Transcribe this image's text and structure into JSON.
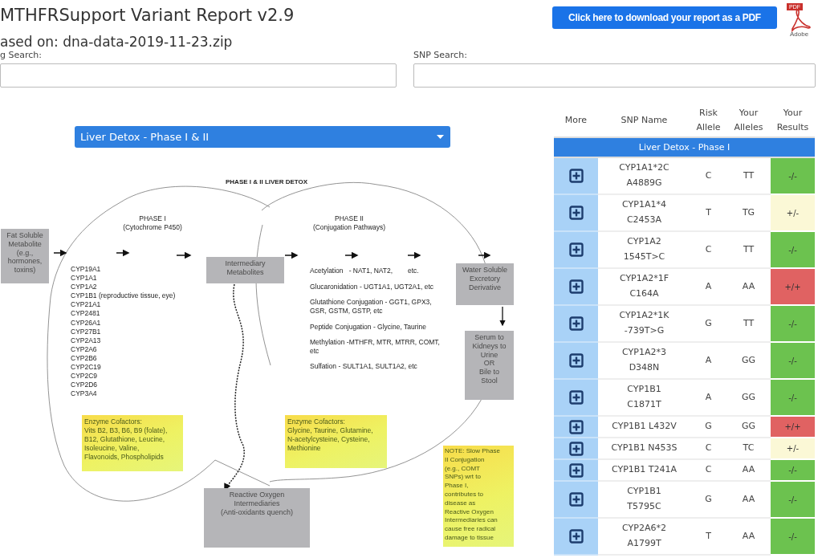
{
  "header": {
    "title": "MTHFRSupport Variant Report v2.9",
    "based_on": "ased on: dna-data-2019-11-23.zip",
    "download_button": "Click here to download your report as a PDF",
    "pdf_icon": {
      "badge": "PDF",
      "caption": "Adobe"
    }
  },
  "searches": [
    {
      "label": "g Search:"
    },
    {
      "label": "SNP Search:"
    }
  ],
  "category_select": {
    "value": "Liver Detox - Phase I & II"
  },
  "diagram": {
    "title": "PHASE I & II LIVER DETOX",
    "boxes": [
      {
        "text": "Fat Soluble\nMetabolite\n(e.g.,\nhormones,\ntoxins)"
      },
      {
        "text": "Intermediary\nMetabolites"
      },
      {
        "text": "Water Soluble\nExcretory\nDerivative"
      },
      {
        "text": "Serum to\nKidneys to\nUrine\nOR\nBile to\nStool"
      },
      {
        "text": "Reactive Oxygen\nIntermediaries\n(Anti-oxidants quench)"
      }
    ],
    "phase_1": {
      "title": "PHASE I",
      "subtitle": "(Cytochrome P450)",
      "enzymes": [
        "CYP19A1",
        "CYP1A1",
        "CYP1A2",
        "CYP1B1 (reproductive tissue, eye)",
        "CYP21A1",
        "CYP2481",
        "CYP26A1",
        "CYP27B1",
        "CYP2A13",
        "CYP2A6",
        "CYP2B6",
        "CYP2C19",
        "CYP2C9",
        "CYP2D6",
        "CYP3A4"
      ],
      "cofactors": "Enzyme Cofactors:\nVits B2, B3, B6, B9 (folate),\nB12, Glutathione, Leucine,\nIsoleucine, Valine,\nFlavonoids, Phospholipids"
    },
    "phase_2": {
      "title": "PHASE II",
      "subtitle": "(Conjugation Pathways)",
      "pathways": [
        "Acetylation   - NAT1, NAT2,        etc.",
        "Glucaronidation - UGT1A1, UGT2A1, etc",
        "Glutathione Conjugation - GGT1, GPX3, GSR, GSTM, GSTP, etc",
        "Peptide Conjugation - Glycine, Taurine",
        "Methylation -MTHFR, MTR, MTRR, COMT, etc",
        "Sulfation - SULT1A1, SULT1A2, etc"
      ],
      "cofactors": "Enzyme Cofactors:\nGlycine, Taurine, Glutamine,\nN-acetylcysteine, Cysteine,\nMethionine"
    },
    "note": "NOTE: Slow Phase\nII Conjugation\n(e.g., COMT\nSNPs) wrt to\nPhase I,\ncontributes to\ndisease as\nReactive Oxygen\nIntermediaries can\ncause free radical\ndamage to tissue"
  },
  "table": {
    "columns": [
      "More",
      "SNP Name",
      "Risk\nAllele",
      "Your\nAlleles",
      "Your\nResults"
    ],
    "group": "Liver Detox - Phase I",
    "rows": [
      {
        "snp": "CYP1A1*2C\nA4889G",
        "risk_allele": "C",
        "your_alleles": "TT",
        "result": "-/-",
        "color": "#6cc24f"
      },
      {
        "snp": "CYP1A1*4\nC2453A",
        "risk_allele": "T",
        "your_alleles": "TG",
        "result": "+/-",
        "color": "#fbf8d6"
      },
      {
        "snp": "CYP1A2\n1545T>C",
        "risk_allele": "C",
        "your_alleles": "TT",
        "result": "-/-",
        "color": "#6cc24f"
      },
      {
        "snp": "CYP1A2*1F\nC164A",
        "risk_allele": "A",
        "your_alleles": "AA",
        "result": "+/+",
        "color": "#e06262"
      },
      {
        "snp": "CYP1A2*1K\n-739T>G",
        "risk_allele": "G",
        "your_alleles": "TT",
        "result": "-/-",
        "color": "#6cc24f"
      },
      {
        "snp": "CYP1A2*3\nD348N",
        "risk_allele": "A",
        "your_alleles": "GG",
        "result": "-/-",
        "color": "#6cc24f"
      },
      {
        "snp": "CYP1B1\nC1871T",
        "risk_allele": "A",
        "your_alleles": "GG",
        "result": "-/-",
        "color": "#6cc24f"
      },
      {
        "snp": "CYP1B1 L432V",
        "risk_allele": "G",
        "your_alleles": "GG",
        "result": "+/+",
        "color": "#e06262"
      },
      {
        "snp": "CYP1B1 N453S",
        "risk_allele": "C",
        "your_alleles": "TC",
        "result": "+/-",
        "color": "#fbf8d6"
      },
      {
        "snp": "CYP1B1 T241A",
        "risk_allele": "C",
        "your_alleles": "AA",
        "result": "-/-",
        "color": "#6cc24f"
      },
      {
        "snp": "CYP1B1\nT5795C",
        "risk_allele": "G",
        "your_alleles": "AA",
        "result": "-/-",
        "color": "#6cc24f"
      },
      {
        "snp": "CYP2A6*2\nA1799T",
        "risk_allele": "T",
        "your_alleles": "AA",
        "result": "-/-",
        "color": "#6cc24f"
      }
    ]
  }
}
